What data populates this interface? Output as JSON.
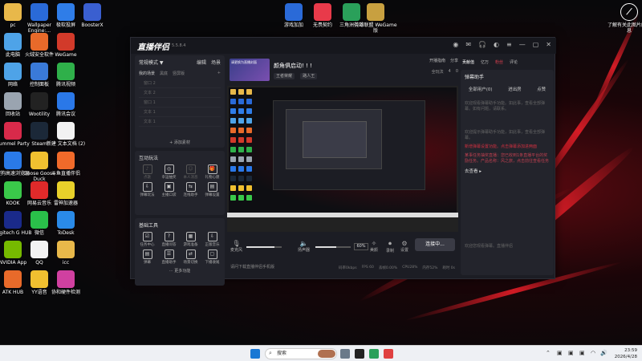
{
  "desktop": {
    "left_icons": [
      {
        "label": "pc",
        "icon": "folder-icon",
        "color": "#e8b84a"
      },
      {
        "label": "Wallpaper Engine:...",
        "icon": "wallpaper-engine-icon",
        "color": "#2a6ad8"
      },
      {
        "label": "极软投屏",
        "icon": "cast-icon",
        "color": "#2f7de8"
      },
      {
        "label": "BoosterX",
        "icon": "boosterx-icon",
        "color": "#3a5fd0"
      },
      {
        "label": "此电脑",
        "icon": "computer-icon",
        "color": "#4ea3e8"
      },
      {
        "label": "火绒安全软件",
        "icon": "huorong-icon",
        "color": "#e86a2a"
      },
      {
        "label": "WeGame",
        "icon": "wegame-icon",
        "color": "#d23a2a"
      },
      {
        "label": "网络",
        "icon": "network-icon",
        "color": "#4ea3e8"
      },
      {
        "label": "控制面板",
        "icon": "control-panel-icon",
        "color": "#3a7ad8"
      },
      {
        "label": "腾讯视频",
        "icon": "tencent-video-icon",
        "color": "#2fb04a"
      },
      {
        "label": "回收站",
        "icon": "recycle-bin-icon",
        "color": "#9aa4b0"
      },
      {
        "label": "Wootility",
        "icon": "wootility-icon",
        "color": "#222222"
      },
      {
        "label": "腾讯会议",
        "icon": "tencent-meeting-icon",
        "color": "#2a78e8"
      },
      {
        "label": "Pummel Party",
        "icon": "pummel-party-icon",
        "color": "#d82a4a"
      },
      {
        "label": "Steam",
        "icon": "steam-icon",
        "color": "#1b2838"
      },
      {
        "label": "新建 文本文档 (2)",
        "icon": "text-file-icon",
        "color": "#f2f2f2"
      },
      {
        "label": "搜狗高速浏览器",
        "icon": "sogou-browser-icon",
        "color": "#2a7ae8"
      },
      {
        "label": "Goose Goose Duck",
        "icon": "goose-duck-icon",
        "color": "#f0c030"
      },
      {
        "label": "斗鱼直播伴侣",
        "icon": "douyu-icon",
        "color": "#f06a2a"
      },
      {
        "label": "KOOK",
        "icon": "kook-icon",
        "color": "#3ac84a"
      },
      {
        "label": "网易云音乐",
        "icon": "netease-music-icon",
        "color": "#e02a2a"
      },
      {
        "label": "雷神加速器",
        "icon": "leishen-icon",
        "color": "#e8d02a"
      },
      {
        "label": "Logitech G HUB",
        "icon": "logitech-icon",
        "color": "#1a2a8a"
      },
      {
        "label": "微信",
        "icon": "wechat-icon",
        "color": "#2ac04a"
      },
      {
        "label": "ToDesk",
        "icon": "todesk-icon",
        "color": "#2a8ae8"
      },
      {
        "label": "NVIDIA App",
        "icon": "nvidia-icon",
        "color": "#76b900"
      },
      {
        "label": "QQ",
        "icon": "qq-icon",
        "color": "#f2f2f2"
      },
      {
        "label": "icc",
        "icon": "folder-icon",
        "color": "#e8b84a"
      },
      {
        "label": "ATK HUB",
        "icon": "atk-hub-icon",
        "color": "#e86a2a"
      },
      {
        "label": "YY语音",
        "icon": "yy-icon",
        "color": "#f0c030"
      },
      {
        "label": "协和硬件检测",
        "icon": "hardware-check-icon",
        "color": "#d040a0"
      }
    ],
    "top_icons": [
      {
        "label": "游戏加加",
        "icon": "youxijiajia-icon",
        "color": "#2a6ad8"
      },
      {
        "label": "无畏契约",
        "icon": "valorant-icon",
        "color": "#e83a4a"
      },
      {
        "label": "三角洲行动",
        "icon": "delta-force-icon",
        "color": "#2aa05a"
      },
      {
        "label": "英雄联盟 WeGame版",
        "icon": "lol-icon",
        "color": "#c8a040"
      }
    ],
    "right_icon": {
      "label": "了解有关此图片的信息",
      "icon": "info-icon"
    }
  },
  "app": {
    "name": "直播伴侣",
    "version": "5.5.8.4",
    "mode": "常规模式 ▼",
    "edit_label": "编辑",
    "scene_label": "场景",
    "scene_tabs": [
      "我的场景",
      "黑底",
      "竖屏版"
    ],
    "scene_items": [
      "窗口 2",
      "文本 2",
      "窗口 1",
      "文本 1",
      "文本 1"
    ],
    "add_source": "+ 添加素材",
    "interact_title": "互动玩法",
    "interact_tools": [
      "点歌",
      "幸运抽奖",
      "本人消息",
      "礼物心愿",
      "弹幕玩法",
      "主播口袋",
      "连线助手",
      "弹幕设置"
    ],
    "basic_title": "基础工具",
    "basic_tools": [
      "任务中心",
      "直播问答",
      "游戏准备",
      "正版音乐",
      "弹幕",
      "直播助手",
      "场景切换",
      "下播收尾"
    ],
    "more_tools": "⋯ 更多功能",
    "stream_title": "颜角俱启动! ! !",
    "stream_tags": [
      "王者荣耀",
      "路人王"
    ],
    "top_actions": [
      "开播指南",
      "分享"
    ],
    "sub_actions": [
      "全玩法",
      "4",
      "0"
    ],
    "thumb_text": "请更换为直播封面",
    "mic_label": "麦克风",
    "speaker_label": "扬声器",
    "mic_level": 0.8,
    "speaker_level": 0.6,
    "speaker_pct": "60%",
    "tools": [
      "美颜",
      "录制",
      "设置"
    ],
    "start_live": "连接中...",
    "hint": "请问下载直播伴侣手机版",
    "stats": [
      "码率0kbps",
      "FPS 60",
      "丢帧0.00%",
      "CPU28%",
      "内存52%",
      "耗时 0s"
    ],
    "right_top": [
      "贡献值",
      "亿万",
      "粉丝",
      "评论"
    ],
    "right_panel_title": "弹幕助手",
    "right_tabs": [
      "全部用户(0)",
      "进出房",
      "点赞"
    ],
    "right_p1": "欢迎观看弹幕助手功能。如此事，查看全部弹幕。如有问题，请联系。",
    "right_p2": "欢迎提示弹幕助手功能，如此事，查看全部弹幕。",
    "right_link": "新增弹幕设置功能。点击弹幕添加进两面",
    "right_p3": "某事任务抽奖直播：您已收到1条直播平台的奖励任务。产品名称：风之旅，点击前往查看任务",
    "right_check": "去查看 ▸",
    "right_footer": "欢迎您观看弹幕。直播伴侣"
  },
  "taskbar": {
    "search_placeholder": "搜索",
    "time": "23:59",
    "date": "2026/4/28"
  }
}
